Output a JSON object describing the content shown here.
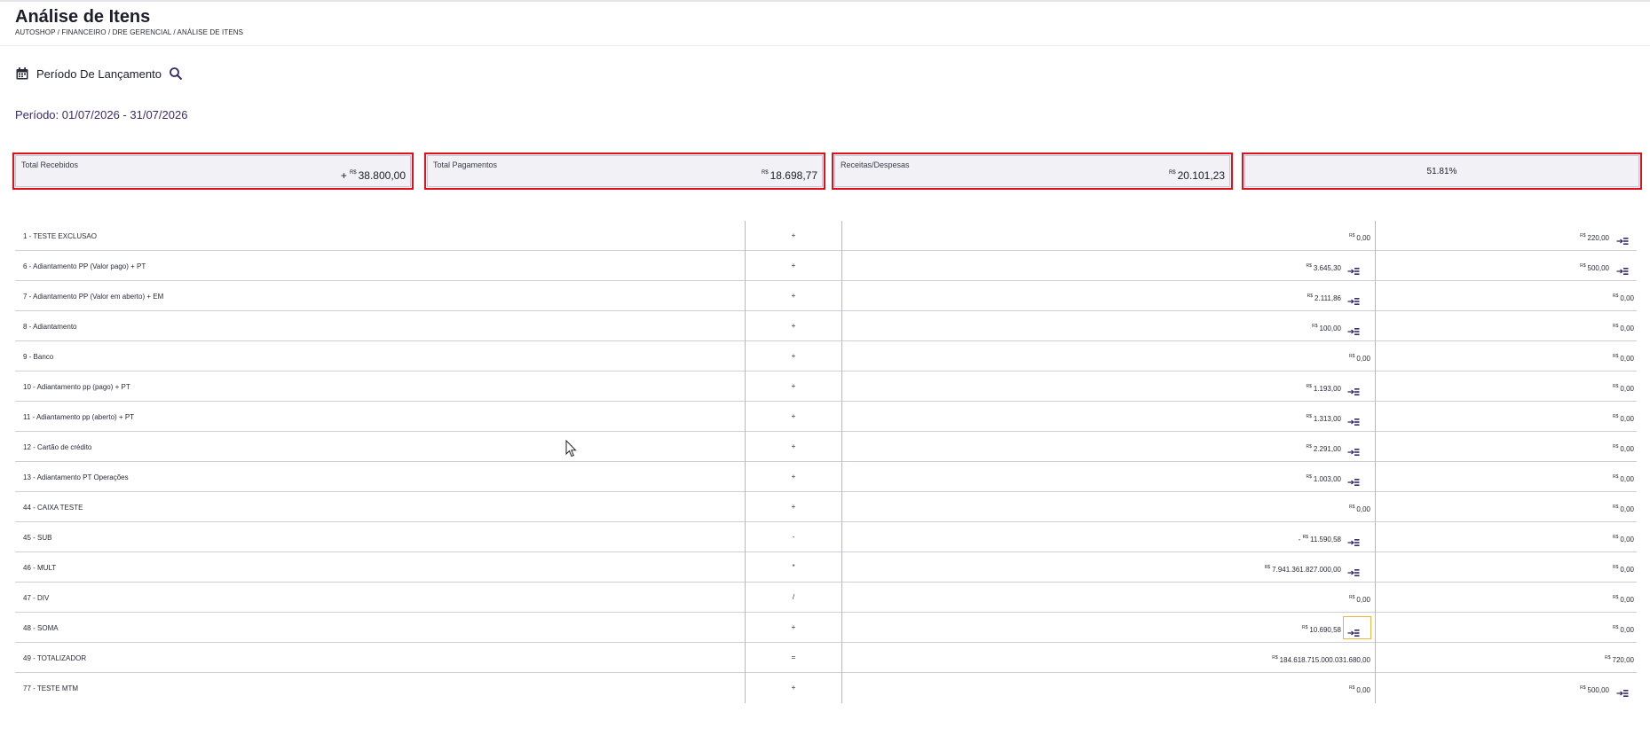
{
  "header": {
    "title": "Análise de Itens",
    "breadcrumb": "AUTOSHOP / FINANCEIRO / DRE GERENCIAL / ANÁLISE DE ITENS"
  },
  "filter": {
    "icon": "calendar-icon",
    "label": "Período De Lançamento",
    "search_icon": "search-icon"
  },
  "period": "Período: 01/07/2026 - 31/07/2026",
  "summary": {
    "currency": "R$",
    "cards": [
      {
        "label": "Total Recebidos",
        "sign": "+",
        "value": "38.800,00"
      },
      {
        "label": "Total Pagamentos",
        "sign": "",
        "value": "18.698,77"
      },
      {
        "label": "Receitas/Despesas",
        "sign": "",
        "value": "20.101,23"
      }
    ],
    "percentage": "51.81%"
  },
  "table": {
    "currency": "R$",
    "rows": [
      {
        "name": "1 - TESTE EXCLUSAO",
        "op": "+",
        "v1": "0,00",
        "v1_sign": "",
        "v1_icon": false,
        "v2": "220,00",
        "v2_icon": true
      },
      {
        "name": "6 - Adiantamento PP (Valor pago) + PT",
        "op": "+",
        "v1": "3.645,30",
        "v1_sign": "",
        "v1_icon": true,
        "v2": "500,00",
        "v2_icon": true
      },
      {
        "name": "7 - Adiantamento PP (Valor em aberto) + EM",
        "op": "+",
        "v1": "2.111,86",
        "v1_sign": "",
        "v1_icon": true,
        "v2": "0,00",
        "v2_icon": false
      },
      {
        "name": "8 - Adiantamento",
        "op": "+",
        "v1": "100,00",
        "v1_sign": "",
        "v1_icon": true,
        "v2": "0,00",
        "v2_icon": false
      },
      {
        "name": "9 - Banco",
        "op": "+",
        "v1": "0,00",
        "v1_sign": "",
        "v1_icon": false,
        "v2": "0,00",
        "v2_icon": false
      },
      {
        "name": "10 - Adiantamento pp (pago) + PT",
        "op": "+",
        "v1": "1.193,00",
        "v1_sign": "",
        "v1_icon": true,
        "v2": "0,00",
        "v2_icon": false
      },
      {
        "name": "11 - Adiantamento pp (aberto) + PT",
        "op": "+",
        "v1": "1.313,00",
        "v1_sign": "",
        "v1_icon": true,
        "v2": "0,00",
        "v2_icon": false
      },
      {
        "name": "12 - Cartão de crédito",
        "op": "+",
        "v1": "2.291,00",
        "v1_sign": "",
        "v1_icon": true,
        "v2": "0,00",
        "v2_icon": false
      },
      {
        "name": "13 - Adiantamento PT Operações",
        "op": "+",
        "v1": "1.003,00",
        "v1_sign": "",
        "v1_icon": true,
        "v2": "0,00",
        "v2_icon": false
      },
      {
        "name": "44 - CAIXA TESTE",
        "op": "+",
        "v1": "0,00",
        "v1_sign": "",
        "v1_icon": false,
        "v2": "0,00",
        "v2_icon": false
      },
      {
        "name": "45 - SUB",
        "op": "-",
        "v1": "11.590,58",
        "v1_sign": "-",
        "v1_icon": true,
        "v2": "0,00",
        "v2_icon": false
      },
      {
        "name": "46 - MULT",
        "op": "*",
        "v1": "7.941.361.827.000,00",
        "v1_sign": "",
        "v1_icon": true,
        "v2": "0,00",
        "v2_icon": false
      },
      {
        "name": "47 - DIV",
        "op": "/",
        "v1": "0,00",
        "v1_sign": "",
        "v1_icon": false,
        "v2": "0,00",
        "v2_icon": false
      },
      {
        "name": "48 - SOMA",
        "op": "+",
        "v1": "10.690,58",
        "v1_sign": "",
        "v1_icon": true,
        "v1_focus": true,
        "v2": "0,00",
        "v2_icon": false
      },
      {
        "name": "49 - TOTALIZADOR",
        "op": "=",
        "v1": "184.618.715.000.031.680,00",
        "v1_sign": "",
        "v1_icon": false,
        "v2": "720,00",
        "v2_icon": false
      },
      {
        "name": "77 - TESTE MTM",
        "op": "+",
        "v1": "0,00",
        "v1_sign": "",
        "v1_icon": false,
        "v2": "500,00",
        "v2_icon": true
      }
    ]
  },
  "colors": {
    "highlight_border": "#e1101a",
    "accent": "#3b2a6b",
    "focus": "#f0b43a",
    "icon": "#3a2a6a"
  }
}
